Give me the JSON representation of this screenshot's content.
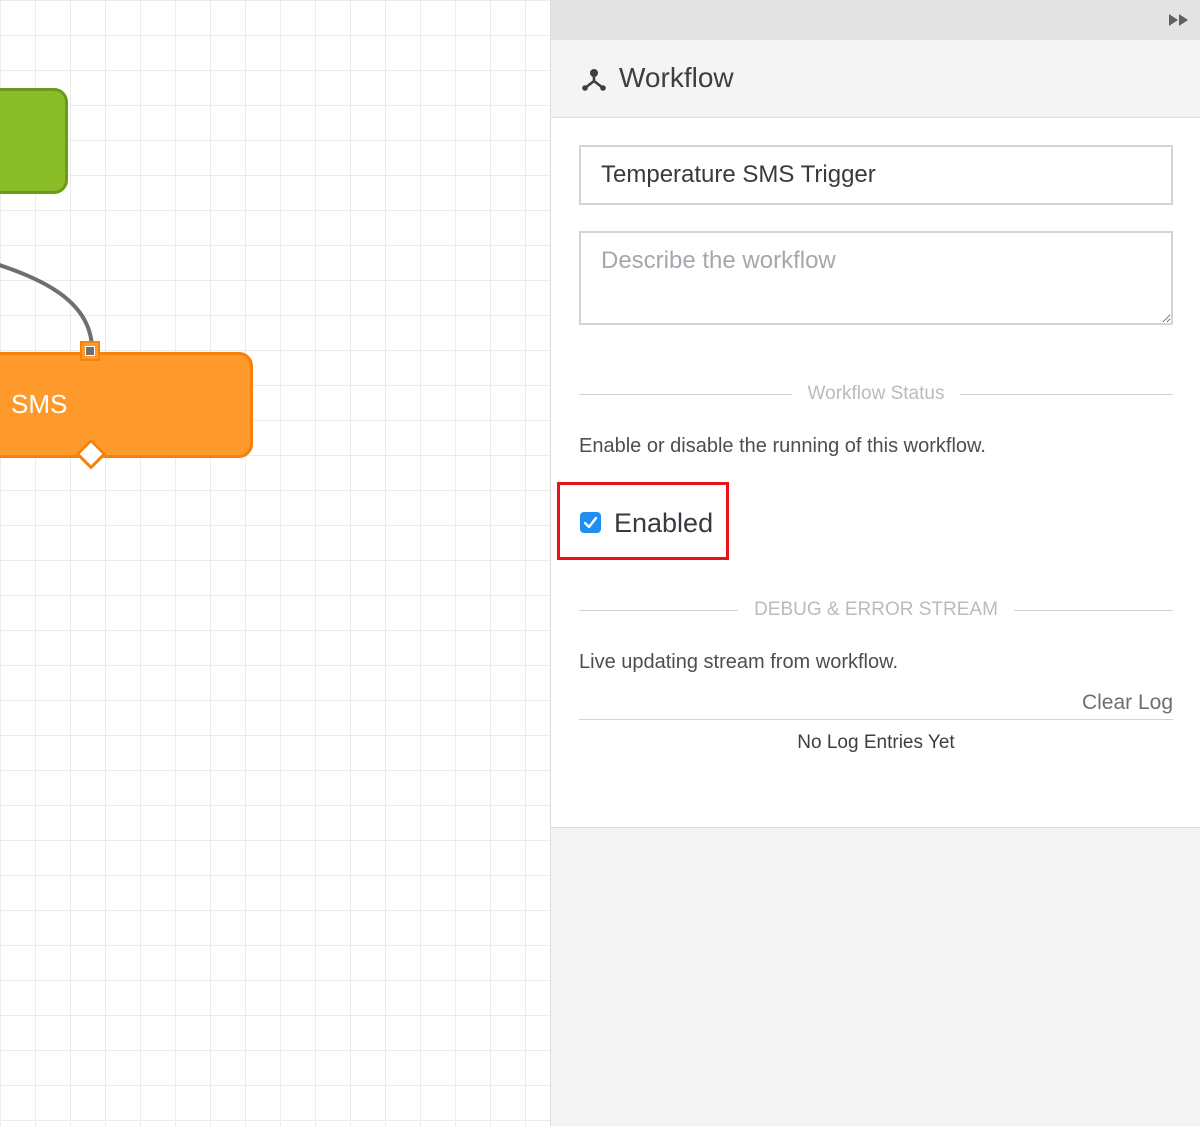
{
  "canvas": {
    "sms_node_label": "SMS"
  },
  "panel": {
    "title": "Workflow",
    "name_value": "Temperature SMS Trigger",
    "description_placeholder": "Describe the workflow",
    "status_section": {
      "heading": "Workflow Status",
      "help": "Enable or disable the running of this workflow.",
      "enabled_label": "Enabled",
      "enabled": true
    },
    "debug_section": {
      "heading": "DEBUG & ERROR STREAM",
      "help": "Live updating stream from workflow.",
      "clear_label": "Clear Log",
      "empty_text": "No Log Entries Yet"
    }
  },
  "icons": {
    "collapse": "double-chevron-right-icon",
    "workflow": "workflow-icon"
  },
  "colors": {
    "accent_blue": "#1f8ef1",
    "highlight_red": "#e8121a",
    "node_orange": "#fe9a2b",
    "node_green": "#8abd28"
  }
}
